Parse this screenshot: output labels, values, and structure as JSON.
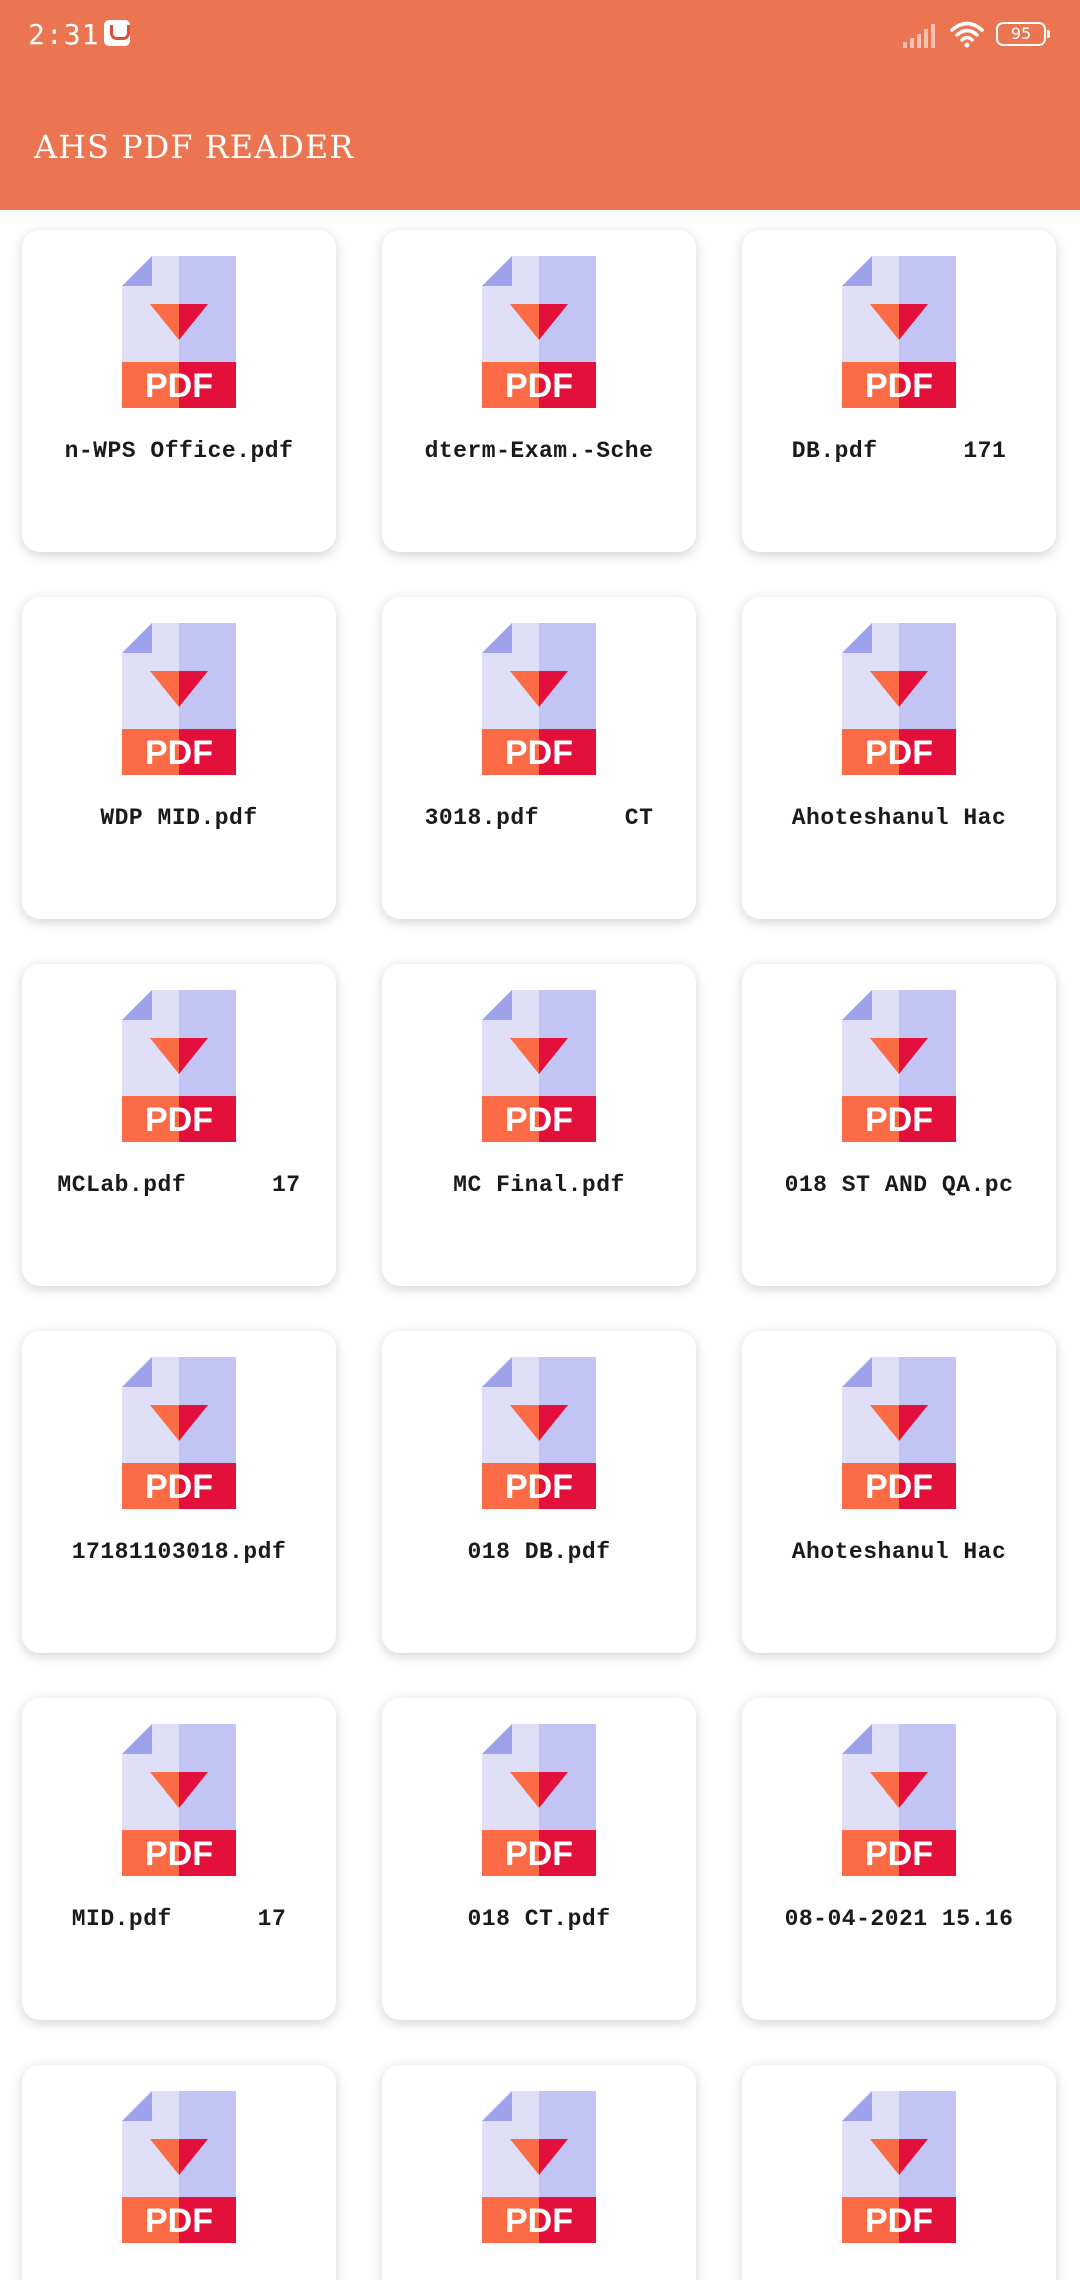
{
  "status_bar": {
    "time": "2:31",
    "battery": "95"
  },
  "app_bar": {
    "title": "AHS PDF READER"
  },
  "files": [
    {
      "name": "n-WPS Office.pdf"
    },
    {
      "name": "dterm-Exam.-Sche"
    },
    {
      "name": "DB.pdf      171"
    },
    {
      "name": "WDP MID.pdf"
    },
    {
      "name": "3018.pdf      CT"
    },
    {
      "name": "Ahoteshanul Hac"
    },
    {
      "name": "MCLab.pdf      17"
    },
    {
      "name": "MC Final.pdf"
    },
    {
      "name": "018 ST AND QA.pc"
    },
    {
      "name": "17181103018.pdf"
    },
    {
      "name": "018 DB.pdf"
    },
    {
      "name": "Ahoteshanul Hac"
    },
    {
      "name": "MID.pdf      17"
    },
    {
      "name": "018 CT.pdf"
    },
    {
      "name": "08-04-2021 15.16"
    },
    {
      "name": ""
    },
    {
      "name": ""
    },
    {
      "name": ""
    }
  ],
  "icons": {
    "file": "pdf-file-icon",
    "label": "PDF"
  },
  "colors": {
    "primary": "#ec7551",
    "pdf_band_left": "#fb6b45",
    "pdf_band_right": "#e3103b",
    "pdf_page_left": "#dfe0f7",
    "pdf_page_right": "#c2c4f3",
    "pdf_fold": "#9ea2ea",
    "arrow_left": "#fb6b45",
    "arrow_right": "#e3103b"
  }
}
